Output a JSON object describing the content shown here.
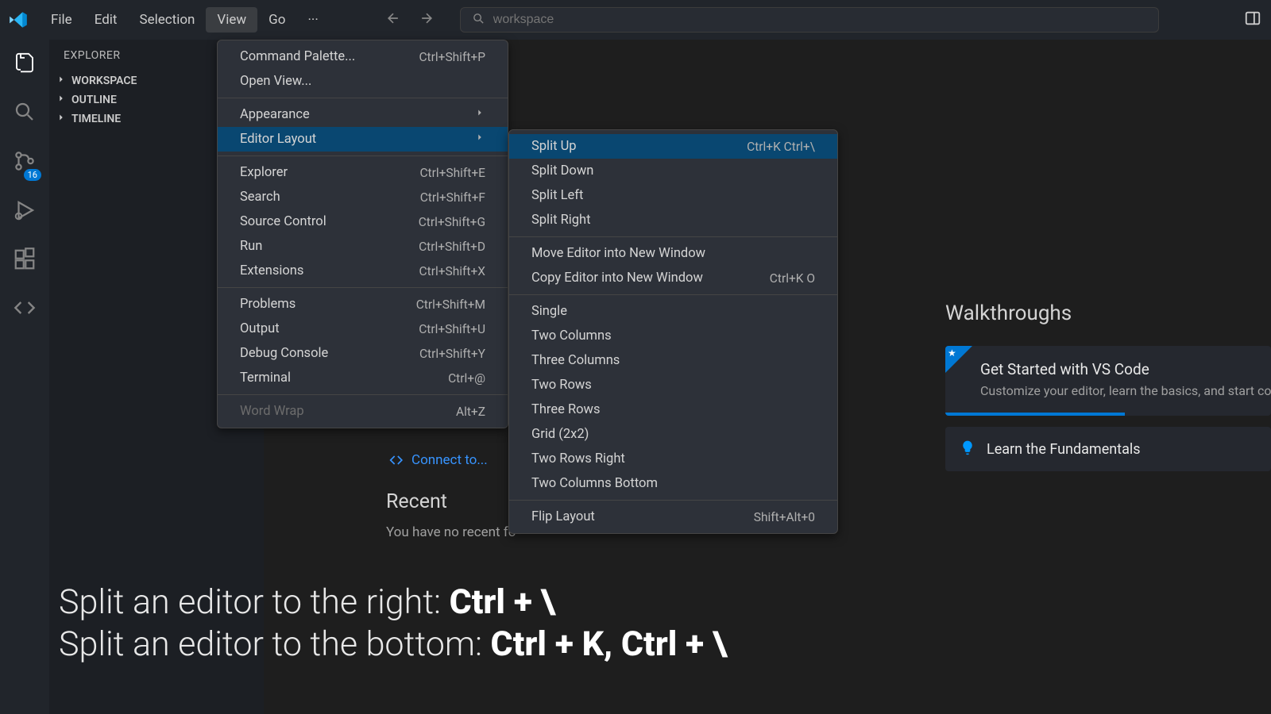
{
  "titlebar": {
    "menus": [
      "File",
      "Edit",
      "Selection",
      "View",
      "Go"
    ],
    "more": "···",
    "search_placeholder": "workspace"
  },
  "activity": {
    "badge_count": "16"
  },
  "sidebar": {
    "header": "EXPLORER",
    "items": [
      "WORKSPACE",
      "OUTLINE",
      "TIMELINE"
    ]
  },
  "view_menu": {
    "groups": [
      [
        {
          "label": "Command Palette...",
          "shortcut": "Ctrl+Shift+P"
        },
        {
          "label": "Open View...",
          "shortcut": ""
        }
      ],
      [
        {
          "label": "Appearance",
          "submenu": true
        },
        {
          "label": "Editor Layout",
          "submenu": true,
          "hover": true
        }
      ],
      [
        {
          "label": "Explorer",
          "shortcut": "Ctrl+Shift+E"
        },
        {
          "label": "Search",
          "shortcut": "Ctrl+Shift+F"
        },
        {
          "label": "Source Control",
          "shortcut": "Ctrl+Shift+G"
        },
        {
          "label": "Run",
          "shortcut": "Ctrl+Shift+D"
        },
        {
          "label": "Extensions",
          "shortcut": "Ctrl+Shift+X"
        }
      ],
      [
        {
          "label": "Problems",
          "shortcut": "Ctrl+Shift+M"
        },
        {
          "label": "Output",
          "shortcut": "Ctrl+Shift+U"
        },
        {
          "label": "Debug Console",
          "shortcut": "Ctrl+Shift+Y"
        },
        {
          "label": "Terminal",
          "shortcut": "Ctrl+@"
        }
      ],
      [
        {
          "label": "Word Wrap",
          "shortcut": "Alt+Z",
          "disabled": true
        }
      ]
    ]
  },
  "submenu": {
    "groups": [
      [
        {
          "label": "Split Up",
          "shortcut": "Ctrl+K Ctrl+\\",
          "hover": true
        },
        {
          "label": "Split Down",
          "shortcut": ""
        },
        {
          "label": "Split Left",
          "shortcut": ""
        },
        {
          "label": "Split Right",
          "shortcut": ""
        }
      ],
      [
        {
          "label": "Move Editor into New Window",
          "shortcut": ""
        },
        {
          "label": "Copy Editor into New Window",
          "shortcut": "Ctrl+K O"
        }
      ],
      [
        {
          "label": "Single",
          "shortcut": ""
        },
        {
          "label": "Two Columns",
          "shortcut": ""
        },
        {
          "label": "Three Columns",
          "shortcut": ""
        },
        {
          "label": "Two Rows",
          "shortcut": ""
        },
        {
          "label": "Three Rows",
          "shortcut": ""
        },
        {
          "label": "Grid (2x2)",
          "shortcut": ""
        },
        {
          "label": "Two Rows Right",
          "shortcut": ""
        },
        {
          "label": "Two Columns Bottom",
          "shortcut": ""
        }
      ],
      [
        {
          "label": "Flip Layout",
          "shortcut": "Shift+Alt+0"
        }
      ]
    ]
  },
  "connect": {
    "label": "Connect to..."
  },
  "recent": {
    "title": "Recent",
    "desc": "You have no recent fo"
  },
  "walkthroughs": {
    "title": "Walkthroughs",
    "primary": {
      "title": "Get Started with VS Code",
      "desc": "Customize your editor, learn the basics, and start co",
      "progress_pct": 55
    },
    "secondary": {
      "title": "Learn the Fundamentals"
    }
  },
  "tips": {
    "line1_pre": "Split an editor to the right: ",
    "line1_bold": "Ctrl + \\",
    "line2_pre": "Split an editor to the bottom: ",
    "line2_bold": "Ctrl + K, Ctrl + \\"
  }
}
